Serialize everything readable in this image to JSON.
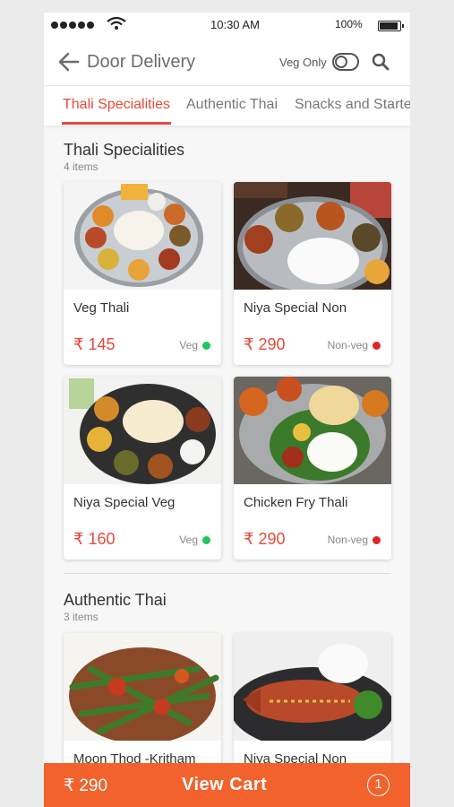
{
  "status_bar": {
    "time": "10:30 AM",
    "battery": "100%"
  },
  "header": {
    "title": "Door Delivery",
    "veg_only_label": "Veg Only"
  },
  "tabs": [
    {
      "label": "Thali Specialities",
      "active": true
    },
    {
      "label": "Authentic Thai",
      "active": false
    },
    {
      "label": "Snacks and Starters",
      "active": false
    }
  ],
  "sections": [
    {
      "title": "Thali Specialities",
      "count": "4 items",
      "items": [
        {
          "name": "Veg Thali",
          "price": "₹ 145",
          "tag": "Veg",
          "tag_color": "#22c55e"
        },
        {
          "name": "Niya Special Non",
          "price": "₹ 290",
          "tag": "Non-veg",
          "tag_color": "#dc2626"
        },
        {
          "name": "Niya Special Veg",
          "price": "₹ 160",
          "tag": "Veg",
          "tag_color": "#22c55e"
        },
        {
          "name": "Chicken Fry Thali",
          "price": "₹ 290",
          "tag": "Non-veg",
          "tag_color": "#dc2626"
        }
      ]
    },
    {
      "title": "Authentic Thai",
      "count": "3 items",
      "items": [
        {
          "name": "Moon Thod -Kritham",
          "price": "",
          "tag": "",
          "tag_color": ""
        },
        {
          "name": "Niya Special Non",
          "price": "",
          "tag": "",
          "tag_color": ""
        }
      ]
    }
  ],
  "cart": {
    "price": "₹ 290",
    "label": "View Cart",
    "count": "1"
  },
  "colors": {
    "accent": "#e8483c",
    "cart_bar": "#f2622c",
    "veg": "#22c55e",
    "non_veg": "#dc2626"
  }
}
